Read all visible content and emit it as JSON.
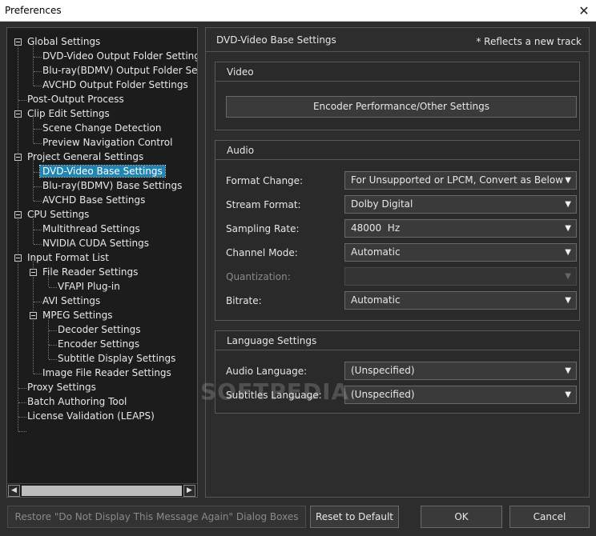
{
  "window": {
    "title": "Preferences"
  },
  "tree": {
    "items": [
      {
        "label": "Global Settings"
      },
      {
        "label": "DVD-Video Output Folder Settings"
      },
      {
        "label": "Blu-ray(BDMV) Output Folder Settings"
      },
      {
        "label": "AVCHD Output Folder Settings"
      },
      {
        "label": "Post-Output Process"
      },
      {
        "label": "Clip Edit Settings"
      },
      {
        "label": "Scene Change Detection"
      },
      {
        "label": "Preview Navigation Control"
      },
      {
        "label": "Project General Settings"
      },
      {
        "label": "DVD-Video Base Settings"
      },
      {
        "label": "Blu-ray(BDMV) Base Settings"
      },
      {
        "label": "AVCHD Base Settings"
      },
      {
        "label": "CPU Settings"
      },
      {
        "label": "Multithread Settings"
      },
      {
        "label": "NVIDIA CUDA Settings"
      },
      {
        "label": "Input Format List"
      },
      {
        "label": "File Reader Settings"
      },
      {
        "label": "VFAPI Plug-in"
      },
      {
        "label": "AVI Settings"
      },
      {
        "label": "MPEG Settings"
      },
      {
        "label": "Decoder Settings"
      },
      {
        "label": "Encoder Settings"
      },
      {
        "label": "Subtitle Display Settings"
      },
      {
        "label": "Image File Reader Settings"
      },
      {
        "label": "Proxy Settings"
      },
      {
        "label": "Batch Authoring Tool"
      },
      {
        "label": "License Validation (LEAPS)"
      }
    ]
  },
  "panel": {
    "title": "DVD-Video Base Settings",
    "note": "* Reflects a new track"
  },
  "video": {
    "title": "Video",
    "encoder_button": "Encoder Performance/Other Settings"
  },
  "audio": {
    "title": "Audio",
    "rows": [
      {
        "label": "Format Change:",
        "value": "For Unsupported or LPCM, Convert as Below"
      },
      {
        "label": "Stream Format:",
        "value": "Dolby Digital"
      },
      {
        "label": "Sampling Rate:",
        "value": "48000  Hz"
      },
      {
        "label": "Channel Mode:",
        "value": "Automatic"
      },
      {
        "label": "Quantization:",
        "value": ""
      },
      {
        "label": "Bitrate:",
        "value": "Automatic"
      }
    ]
  },
  "language": {
    "title": "Language Settings",
    "rows": [
      {
        "label": "Audio Language:",
        "value": "(Unspecified)"
      },
      {
        "label": "Subtitles Language:",
        "value": "(Unspecified)"
      }
    ]
  },
  "watermark": "SOFTPEDIA",
  "buttons": {
    "restore": "Restore \"Do Not Display This Message Again\" Dialog Boxes",
    "reset": "Reset to Default",
    "ok": "OK",
    "cancel": "Cancel"
  }
}
